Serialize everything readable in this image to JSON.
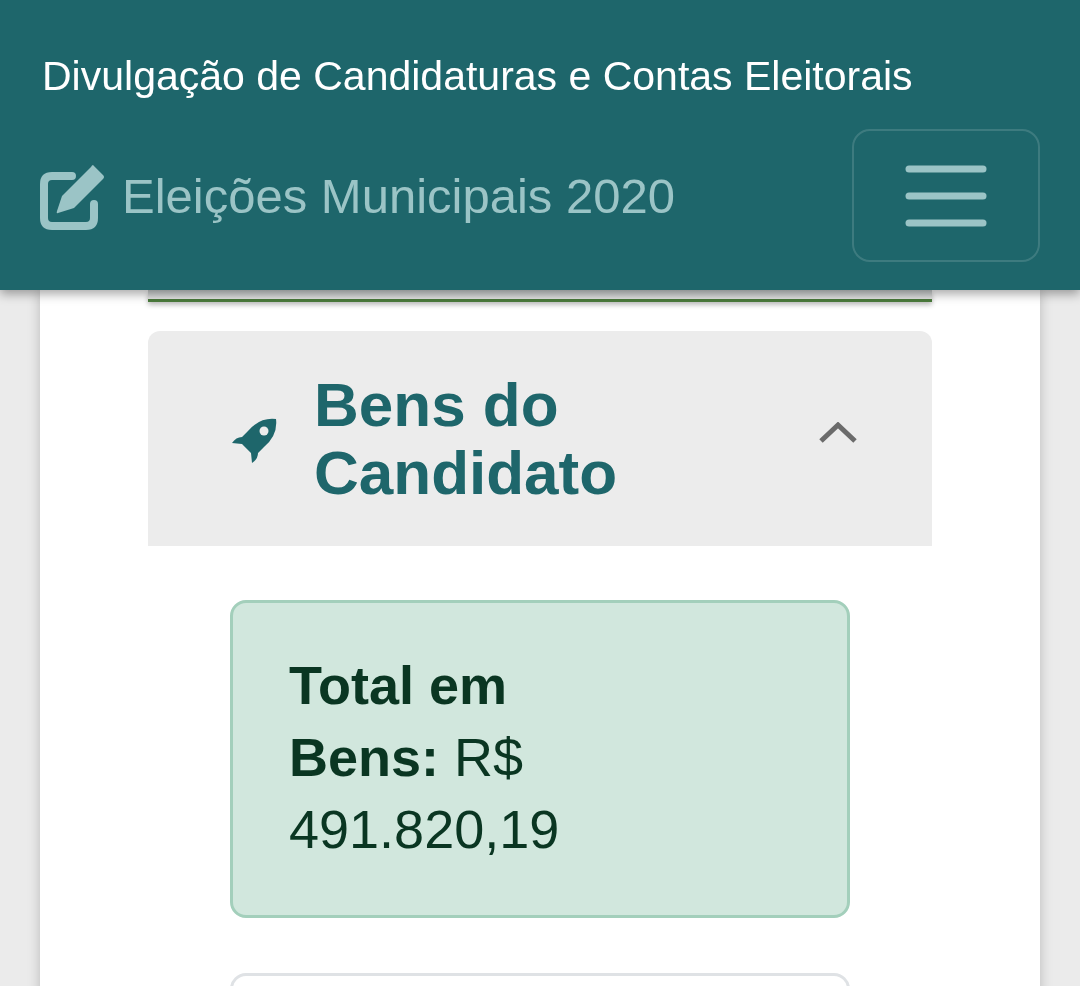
{
  "header": {
    "title": "Divulgação de Candidaturas e Contas Eleitorais",
    "brand": "Eleições Municipais 2020"
  },
  "accordion": {
    "title": "Bens do Candidato",
    "expanded": true,
    "summary": "**Total em Bens:** R$ 491.820,19"
  }
}
